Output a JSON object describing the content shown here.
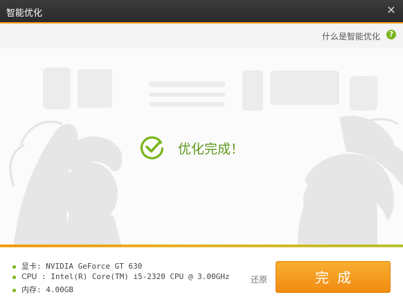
{
  "window": {
    "title": "智能优化",
    "close_symbol": "✕"
  },
  "header": {
    "help_link": "什么是智能优化",
    "help_icon": "?"
  },
  "result": {
    "message": "优化完成！",
    "icon": "check-circle-icon"
  },
  "progress": {
    "fraction": 1.0
  },
  "specs": [
    {
      "label": "显卡",
      "value": "NVIDIA GeForce GT 630"
    },
    {
      "label": "CPU",
      "value": "Intel(R) Core(TM) i5-2320 CPU @ 3.00GHz"
    },
    {
      "label": "内存",
      "value": "4.00GB"
    }
  ],
  "actions": {
    "restore_label": "还原",
    "finish_label": "完成"
  },
  "colors": {
    "accent_green": "#7ab51d",
    "accent_orange": "#f19511",
    "titlebar": "#2e2e2e"
  }
}
